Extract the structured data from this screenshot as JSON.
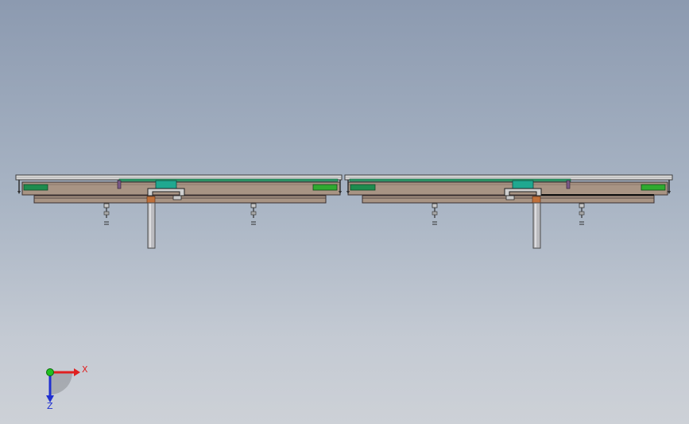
{
  "scene": {
    "background_top": "#8c9ab0",
    "background_bottom": "#cdd1d7"
  },
  "palette": {
    "frame": "#d8d8d8",
    "frame_edge": "#3c3c3c",
    "plate": "#a89484",
    "plate_edge": "#3a3030",
    "green_pad": "#1e8c4e",
    "green_pad_bright": "#2faa30",
    "teal_block": "#20a890",
    "column": "#b8b8bc",
    "copper": "#c0703a",
    "purple": "#7a5a86"
  },
  "triad": {
    "x_label": "X",
    "z_label": "Z",
    "x_color": "#e02020",
    "y_color": "#20c020",
    "z_color": "#2030d0"
  }
}
